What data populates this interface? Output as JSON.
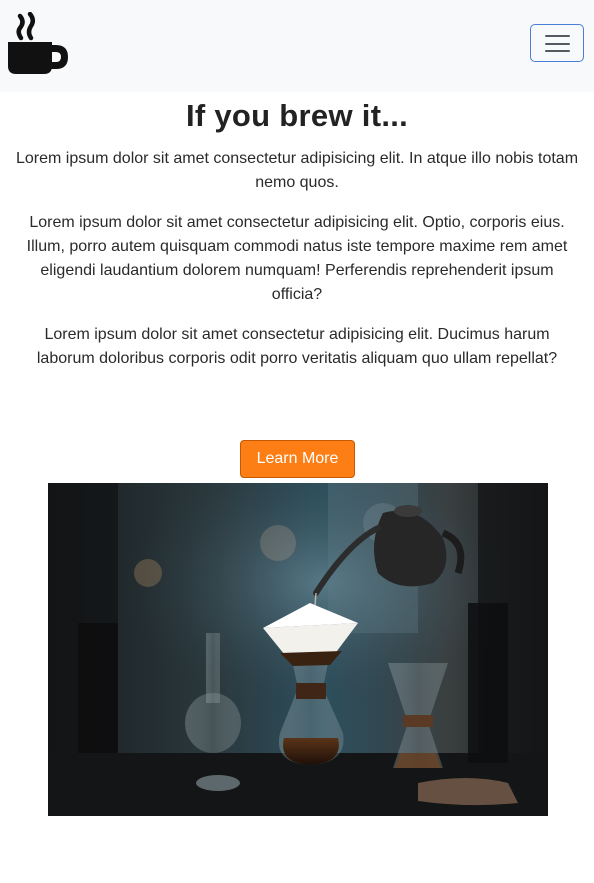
{
  "navbar": {
    "brand_icon": "mug-hot-icon",
    "toggler_icon": "hamburger-menu-icon",
    "toggler_border_color": "#4a7fd8"
  },
  "main": {
    "heading": "If you brew it...",
    "paragraphs": [
      "Lorem ipsum dolor sit amet consectetur adipisicing elit. In atque illo nobis totam nemo quos.",
      "Lorem ipsum dolor sit amet consectetur adipisicing elit. Optio, corporis eius. Illum, porro autem quisquam commodi natus iste tempore maxime rem amet eligendi laudantium dolorem numquam! Perferendis reprehenderit ipsum officia?",
      "Lorem ipsum dolor sit amet consectetur adipisicing elit. Ducimus harum laborum doloribus corporis odit porro veritatis aliquam quo ullam repellat?"
    ],
    "cta_label": "Learn More",
    "cta_color": "#fd7e14"
  },
  "hero_image": {
    "subject": "pour-over-coffee-photo"
  }
}
